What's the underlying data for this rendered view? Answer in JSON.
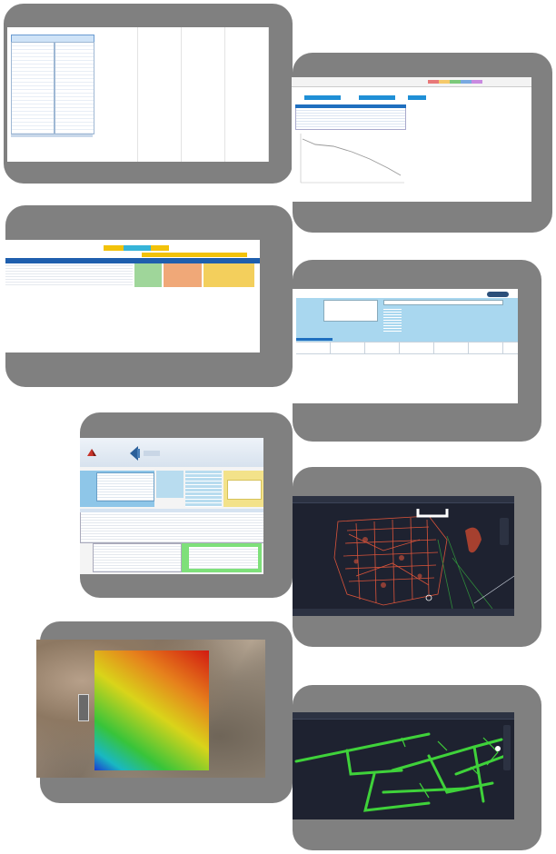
{
  "collage": {
    "title": "",
    "tiles": [
      {
        "id": "tile-1",
        "kind": "spreadsheet",
        "description_text": ""
      },
      {
        "id": "tile-2",
        "kind": "spreadsheet-with-chart"
      },
      {
        "id": "tile-3",
        "kind": "spreadsheet-colored-table"
      },
      {
        "id": "tile-4",
        "kind": "form-dashboard"
      },
      {
        "id": "tile-5",
        "kind": "application-window"
      },
      {
        "id": "tile-6",
        "kind": "cad-red-network"
      },
      {
        "id": "tile-7",
        "kind": "terrain-gradient-overlay"
      },
      {
        "id": "tile-8",
        "kind": "cad-green-network"
      }
    ]
  },
  "colors": {
    "card_gray": "#808080",
    "sheet_blue": "#1f6fbf",
    "cad_background": "#1e2230",
    "cad_red": "#d9533a",
    "cad_green": "#3fd23a",
    "header_yellow": "#f2c20a",
    "panel_light_blue": "#a9d7ef"
  },
  "icons": [
    "app-logo-icon",
    "app-back-arrow-icon"
  ]
}
